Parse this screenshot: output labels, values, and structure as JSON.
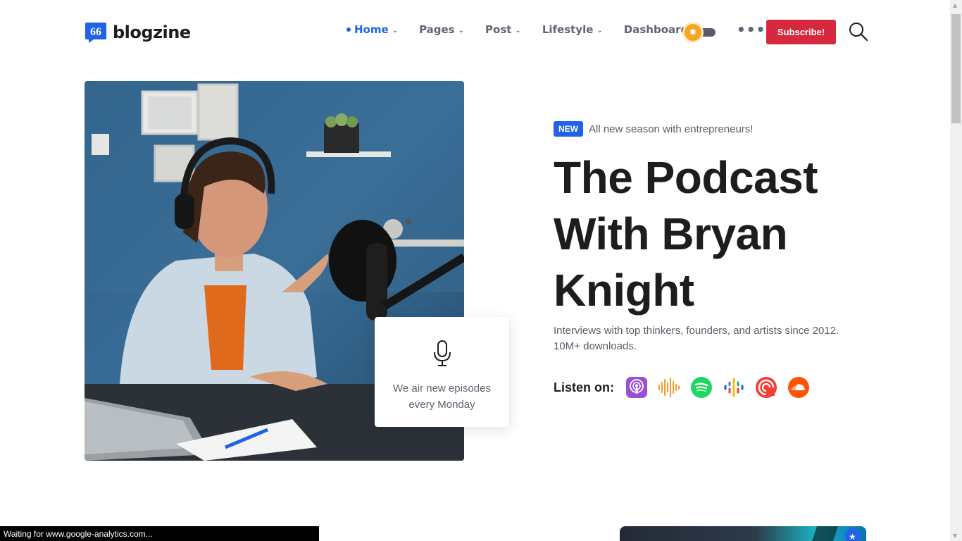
{
  "brand": {
    "name": "blogzine"
  },
  "nav": {
    "items": [
      {
        "label": "Home",
        "active": true
      },
      {
        "label": "Pages"
      },
      {
        "label": "Post"
      },
      {
        "label": "Lifestyle"
      },
      {
        "label": "Dashboard"
      }
    ],
    "subscribe_label": "Subscribe!",
    "more_icon": "ellipsis-icon",
    "search_icon": "search-icon",
    "theme_toggle_icon": "sun-icon"
  },
  "hero": {
    "badge": "NEW",
    "badge_text": "All new season with entrepreneurs!",
    "title": "The Podcast With Bryan Knight",
    "description": "Interviews with top thinkers, founders, and artists since 2012. 10M+ downloads.",
    "card_text": "We air new episodes every Monday",
    "card_icon": "microphone-icon",
    "image_alt": "Woman with headphones podcasting at microphone"
  },
  "listen": {
    "label": "Listen on:",
    "platforms": [
      {
        "name": "Apple Podcasts",
        "icon": "apple-podcasts-icon"
      },
      {
        "name": "Audible",
        "icon": "audio-waves-icon"
      },
      {
        "name": "Spotify",
        "icon": "spotify-icon"
      },
      {
        "name": "Google Podcasts",
        "icon": "google-podcasts-icon"
      },
      {
        "name": "Pocket Casts",
        "icon": "pocket-casts-icon"
      },
      {
        "name": "SoundCloud",
        "icon": "soundcloud-icon"
      }
    ]
  },
  "status_bar": {
    "text": "Waiting for www.google-analytics.com..."
  },
  "colors": {
    "accent": "#2163e8",
    "subscribe": "#d6293e",
    "text": "#1d1d1f",
    "muted": "#595d69"
  }
}
